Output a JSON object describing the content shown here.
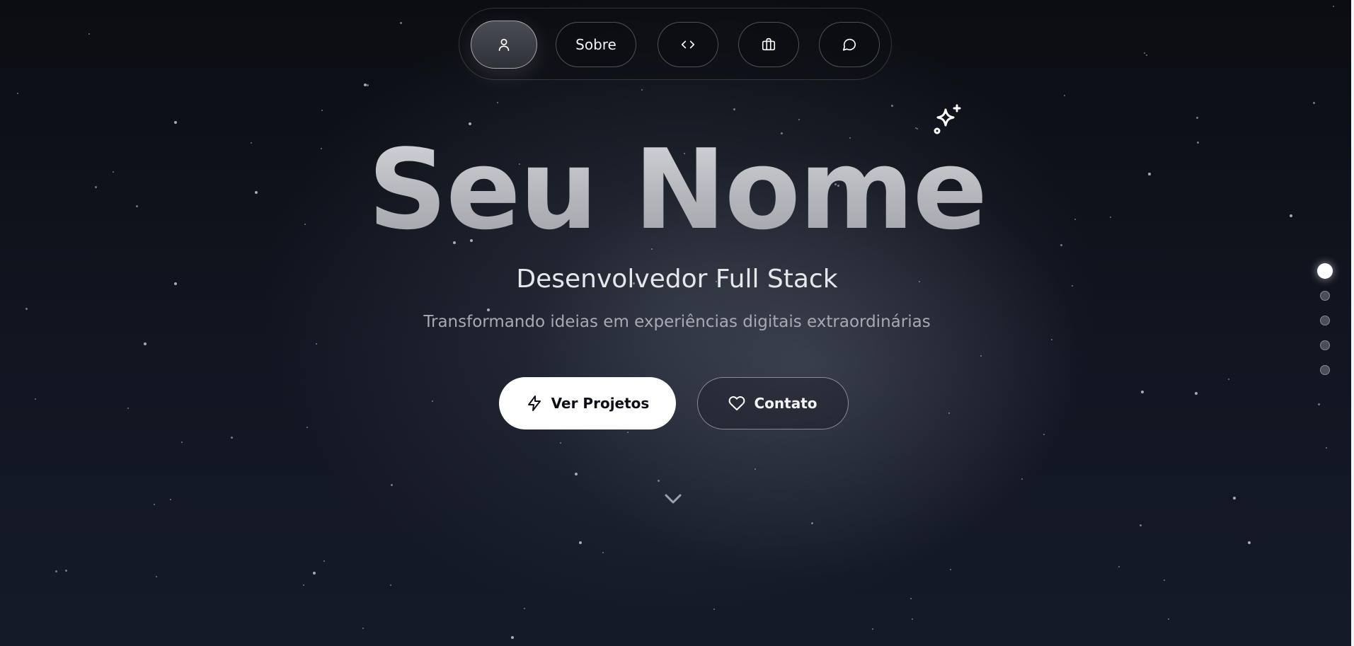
{
  "nav": {
    "items": [
      {
        "icon": "user-icon",
        "label": "",
        "active": true
      },
      {
        "icon": "",
        "label": "Sobre",
        "active": false
      },
      {
        "icon": "code-icon",
        "label": "",
        "active": false
      },
      {
        "icon": "briefcase-icon",
        "label": "",
        "active": false
      },
      {
        "icon": "message-circle-icon",
        "label": "",
        "active": false
      }
    ]
  },
  "hero": {
    "name": "Seu Nome",
    "role": "Desenvolvedor Full Stack",
    "tagline": "Transformando ideias em experiências digitais extraordinárias",
    "sparkle_icon": "sparkles-icon",
    "scroll_icon": "chevron-down-icon"
  },
  "actions": {
    "primary": {
      "label": "Ver Projetos",
      "icon": "zap-icon"
    },
    "secondary": {
      "label": "Contato",
      "icon": "heart-icon"
    }
  },
  "section_indicator": {
    "count": 5,
    "active_index": 0
  },
  "colors": {
    "background": "#0b0f17",
    "primary_button_bg": "#ffffff",
    "primary_button_text": "#0c0f16",
    "title_gradient_top": "#d7d8db",
    "title_gradient_bottom": "#9fa2a8",
    "muted_text": "#a7aab1"
  }
}
